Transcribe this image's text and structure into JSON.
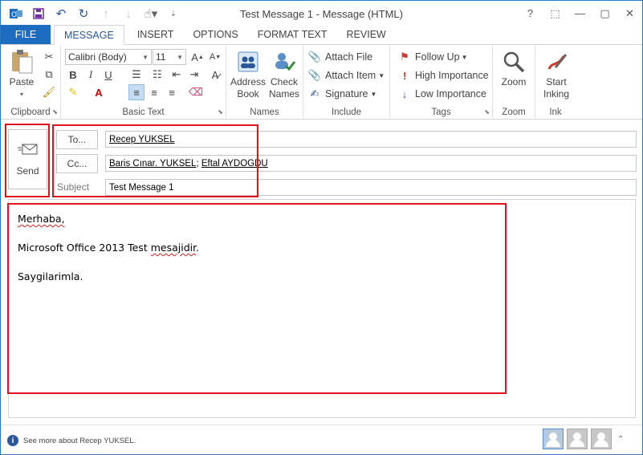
{
  "window": {
    "title": "Test Message 1 - Message (HTML)",
    "controls": [
      "?",
      "⬚",
      "—",
      "▢",
      "✕"
    ]
  },
  "qat": {
    "icons": [
      "outlook-icon",
      "save-icon",
      "undo-icon",
      "redo-icon",
      "up-icon",
      "down-icon",
      "touch-mode-icon",
      "customize-icon"
    ]
  },
  "tabs": [
    "FILE",
    "MESSAGE",
    "INSERT",
    "OPTIONS",
    "FORMAT TEXT",
    "REVIEW"
  ],
  "ribbon": {
    "clipboard": {
      "label": "Clipboard",
      "paste": "Paste"
    },
    "basic_text": {
      "label": "Basic Text",
      "font": "Calibri (Body)",
      "size": "11"
    },
    "names": {
      "label": "Names",
      "address_book": "Address\nBook",
      "check_names": "Check\nNames"
    },
    "include": {
      "label": "Include",
      "attach_file": "Attach File",
      "attach_item": "Attach Item",
      "signature": "Signature"
    },
    "tags": {
      "label": "Tags",
      "follow_up": "Follow Up",
      "high_importance": "High Importance",
      "low_importance": "Low Importance"
    },
    "zoom": {
      "label": "Zoom",
      "zoom": "Zoom"
    },
    "ink": {
      "label": "Ink",
      "start_inking": "Start\nInking"
    }
  },
  "header": {
    "send": "Send",
    "to_label": "To...",
    "to_value": "Recep YUKSEL",
    "cc_label": "Cc...",
    "cc_recipients": [
      "Baris Cınar. YUKSEL",
      "Eftal AYDOGDU"
    ],
    "cc_separator": "; ",
    "subject_label": "Subject",
    "subject_value": "Test Message 1"
  },
  "body": {
    "line1": "Merhaba,",
    "line2_prefix": "Microsoft Office 2013 Test ",
    "line2_misspelled": "mesajidir",
    "line2_suffix": ".",
    "line3": "Saygilarimla."
  },
  "status": {
    "info": "See more about Recep YUKSEL."
  },
  "colors": {
    "accent": "#1e6cc0",
    "highlight": "#e0141e"
  }
}
